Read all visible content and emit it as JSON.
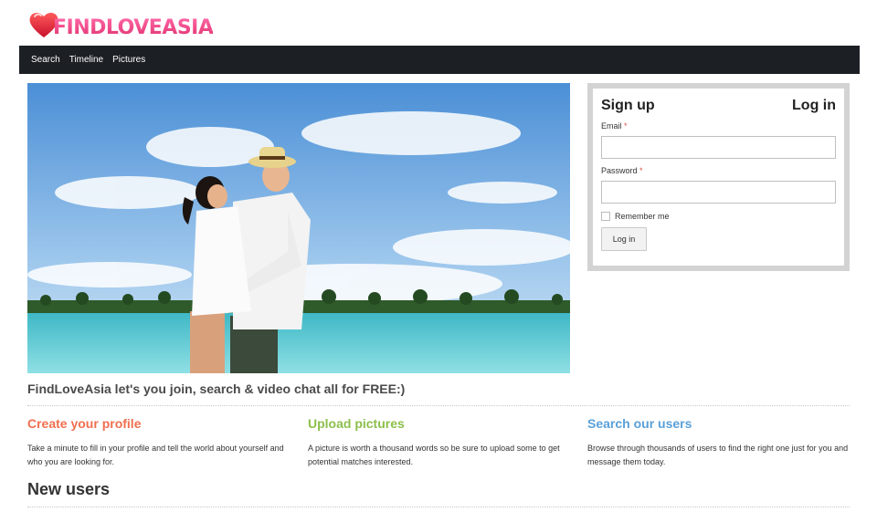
{
  "brand": {
    "logo_text": "FINDLOVEASIA"
  },
  "nav": {
    "items": [
      "Search",
      "Timeline",
      "Pictures"
    ]
  },
  "login": {
    "signup_label": "Sign up",
    "login_label": "Log in",
    "email_label": "Email",
    "password_label": "Password",
    "required_mark": "*",
    "email_value": "",
    "password_value": "",
    "remember_label": "Remember me",
    "submit_label": "Log in"
  },
  "tagline": "FindLoveAsia let's you join, search & video chat all for FREE:)",
  "features": [
    {
      "title": "Create your profile",
      "text": "Take a minute to fill in your profile and tell the world about yourself and who you are looking for."
    },
    {
      "title": "Upload pictures",
      "text": "A picture is worth a thousand words so be sure to upload some to get potential matches interested."
    },
    {
      "title": "Search our users",
      "text": "Browse through thousands of users to find the right one just for you and message them today."
    }
  ],
  "new_users_heading": "New users",
  "colors": {
    "nav_bg": "#1c1f24",
    "brand_pink": "#e0306f",
    "feature1": "#ef6f4f",
    "feature2": "#8cbf4a",
    "feature3": "#5aa0d8"
  }
}
